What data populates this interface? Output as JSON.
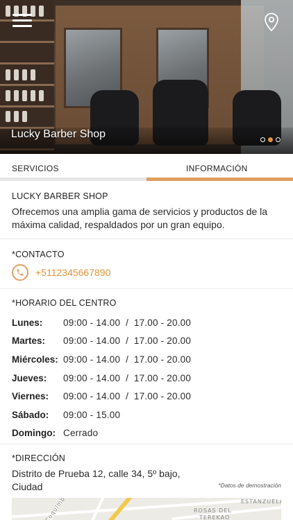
{
  "header": {
    "title": "Lucky Barber Shop",
    "menu_icon": "hamburger-menu-icon",
    "location_icon": "location-pin-icon",
    "carousel_dots": 3,
    "carousel_active_index": 1
  },
  "tabs": [
    {
      "label": "SERVICIOS",
      "active": false
    },
    {
      "label": "INFORMACIÓN",
      "active": true
    }
  ],
  "about": {
    "title": "LUCKY BARBER SHOP",
    "description": "Ofrecemos una amplia gama de servicios y productos de la máxima calidad, respaldados por un gran equipo."
  },
  "contact": {
    "title": "*CONTACTO",
    "phone_icon": "phone-icon",
    "phone": "+5112345667890"
  },
  "hours": {
    "title": "*HORARIO DEL CENTRO",
    "rows": [
      {
        "day": "Lunes:",
        "time": "09:00 - 14.00  /  17.00 - 20.00"
      },
      {
        "day": "Martes:",
        "time": "09:00 - 14.00  /  17.00 - 20.00"
      },
      {
        "day": "Miércoles:",
        "time": "09:00 - 14.00  /  17.00 - 20.00"
      },
      {
        "day": "Jueves:",
        "time": "09:00 - 14.00  /  17.00 - 20.00"
      },
      {
        "day": "Viernes:",
        "time": "09:00 - 14.00  /  17.00 - 20.00"
      },
      {
        "day": "Sábado:",
        "time": "09:00 - 15.00"
      },
      {
        "day": "Domingo:",
        "time": "Cerrado"
      }
    ]
  },
  "address": {
    "title": "*DIRECCIÓN",
    "text": "Distrito de Prueba 12, calle 34, 5º bajo, Ciudad",
    "demo_note": "*Datos de demostración"
  },
  "map": {
    "labels": [
      "ESTANZUELA",
      "ROSAS DEL",
      "TEREKAO",
      "Coquimbo"
    ]
  },
  "colors": {
    "accent": "#e0a060",
    "link": "#e0923a",
    "tab_inactive_bar": "#e6e6e6"
  }
}
